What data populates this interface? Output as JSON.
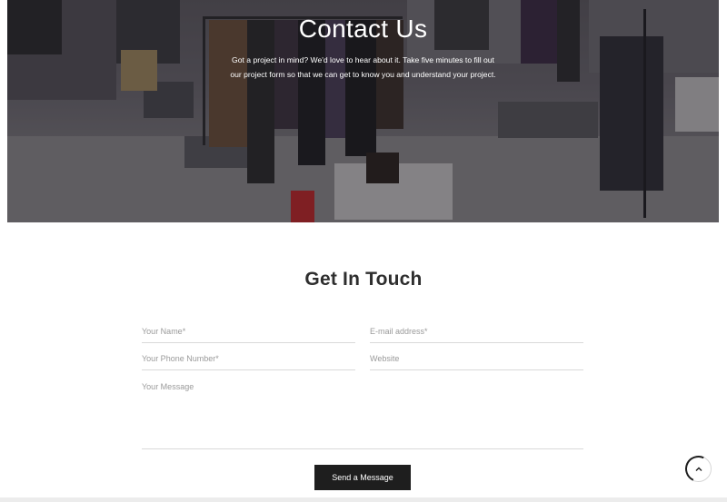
{
  "hero": {
    "title": "Contact Us",
    "subtitle": "Got a project in mind? We'd love to hear about it. Take five minutes to fill out our project form so that we can get to know you and understand your project."
  },
  "contact": {
    "title": "Get In Touch",
    "fields": {
      "name_placeholder": "Your Name*",
      "email_placeholder": "E-mail address*",
      "phone_placeholder": "Your Phone Number*",
      "website_placeholder": "Website",
      "message_placeholder": "Your Message"
    },
    "submit_label": "Send a Message"
  },
  "scroll_top": {
    "icon": "chevron-up-icon"
  },
  "colors": {
    "button": "#1e1e1e",
    "input_border": "#d9d9d9",
    "placeholder": "#9a9a9a"
  }
}
